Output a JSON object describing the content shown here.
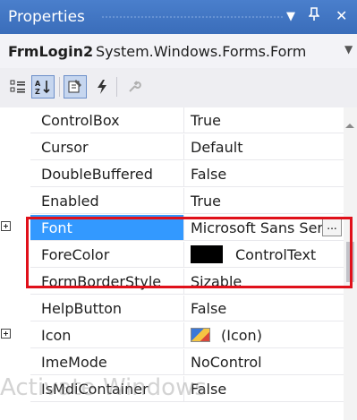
{
  "window": {
    "title": "Properties",
    "dropdown_glyph": "▼",
    "pin_glyph": "ᵽ",
    "close_glyph": "✕"
  },
  "object_selector": {
    "name": "FrmLogin2",
    "type": "System.Windows.Forms.Form"
  },
  "toolbar": {
    "buttons": [
      {
        "icon": "categorized-icon",
        "pressed": false
      },
      {
        "icon": "alphabetical-sort-icon",
        "pressed": true
      },
      {
        "icon": "properties-icon",
        "pressed": true
      },
      {
        "icon": "events-lightning-icon",
        "pressed": false
      },
      {
        "icon": "property-pages-wrench-icon",
        "pressed": false
      }
    ]
  },
  "properties": [
    {
      "name": "ControlBox",
      "value": "True"
    },
    {
      "name": "Cursor",
      "value": "Default"
    },
    {
      "name": "DoubleBuffered",
      "value": "False"
    },
    {
      "name": "Enabled",
      "value": "True"
    },
    {
      "name": "Font",
      "value": "Microsoft Sans Serif",
      "expandable": true,
      "selected": true,
      "ellipsis": "..."
    },
    {
      "name": "ForeColor",
      "value": "ControlText",
      "swatch": "#000000"
    },
    {
      "name": "FormBorderStyle",
      "value": "Sizable"
    },
    {
      "name": "HelpButton",
      "value": "False"
    },
    {
      "name": "Icon",
      "value": "(Icon)",
      "expandable": true
    },
    {
      "name": "ImeMode",
      "value": "NoControl"
    },
    {
      "name": "IsMdiContainer",
      "value": "False"
    }
  ],
  "watermark": "Activate Windows",
  "colors": {
    "title_bar": "#3f74c2",
    "selection": "#3399ff",
    "highlight_box": "#e0101a"
  }
}
